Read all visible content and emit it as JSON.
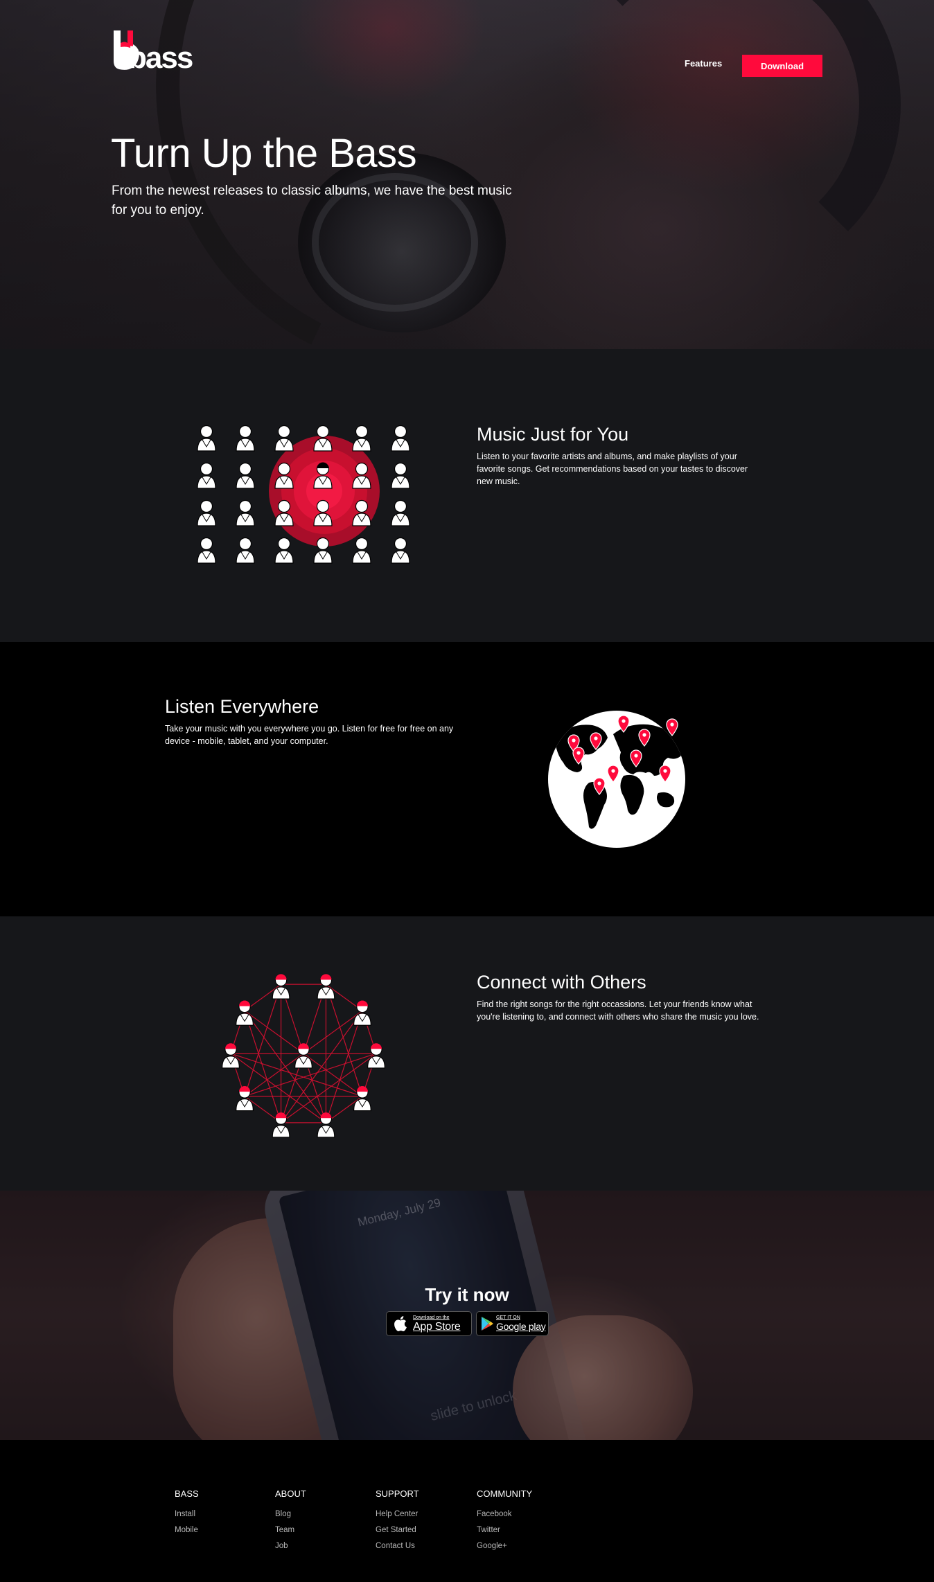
{
  "brand": {
    "name": "bass",
    "accent": "#ff0a3c"
  },
  "nav": {
    "features": "Features",
    "download": "Download"
  },
  "hero": {
    "title": "Turn Up the Bass",
    "subtitle": "From the newest releases to classic albums, we have the best music for you to enjoy."
  },
  "features": [
    {
      "title": "Music Just for You",
      "description": "Listen to your favorite artists and albums, and make playlists of your favorite songs. Get recommendations based on your tastes to discover new music.",
      "icon": "people-grid-target-icon"
    },
    {
      "title": "Listen Everywhere",
      "description": "Take your music with you everywhere you go. Listen for free for free on any device - mobile, tablet, and your computer.",
      "icon": "globe-pins-icon"
    },
    {
      "title": "Connect with Others",
      "description": "Find the right songs for the right occassions. Let your friends know what you're listening to, and connect with others who share the music you love.",
      "icon": "people-network-icon"
    }
  ],
  "try": {
    "title": "Try it now",
    "phone_date": "Monday, July 29",
    "phone_unlock": "slide to unlock",
    "app_store": {
      "small": "Download on the",
      "big": "App Store",
      "icon": "apple-icon"
    },
    "google_play": {
      "small": "GET IT ON",
      "big": "Google play",
      "icon": "play-triangle-icon"
    }
  },
  "footer": {
    "columns": [
      {
        "heading": "BASS",
        "links": [
          "Install",
          "Mobile"
        ]
      },
      {
        "heading": "ABOUT",
        "links": [
          "Blog",
          "Team",
          "Job"
        ]
      },
      {
        "heading": "SUPPORT",
        "links": [
          "Help Center",
          "Get Started",
          "Contact Us"
        ]
      },
      {
        "heading": "COMMUNITY",
        "links": [
          "Facebook",
          "Twitter",
          "Google+"
        ]
      }
    ]
  }
}
